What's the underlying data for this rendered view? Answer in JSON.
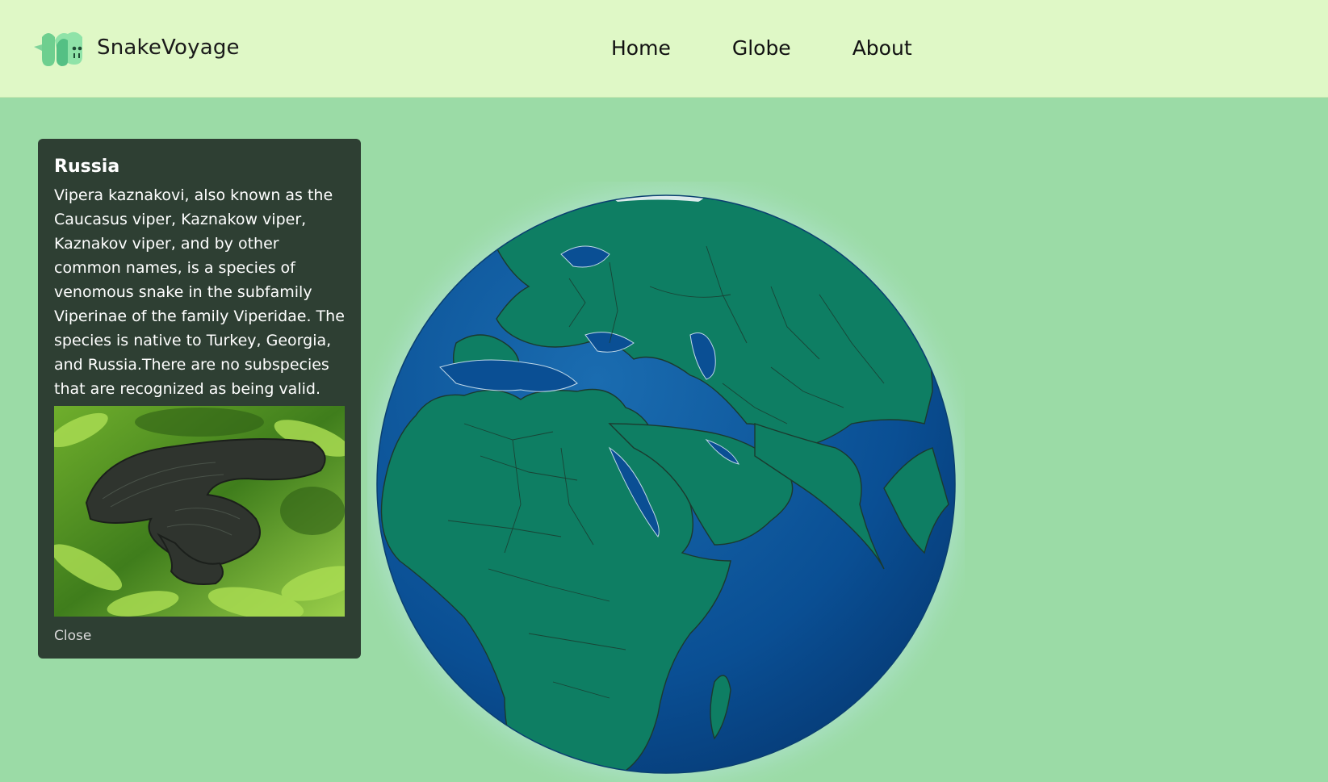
{
  "header": {
    "brand_name": "SnakeVoyage",
    "nav": [
      "Home",
      "Globe",
      "About"
    ]
  },
  "info_panel": {
    "country": "Russia",
    "description": "Vipera kaznakovi, also known as the Caucasus viper, Kaznakow viper, Kaznakov viper, and by other common names, is a species of venomous snake in the subfamily Viperinae of the family Viperidae. The species is native to Turkey, Georgia, and Russia.There are no subspecies that are recognized as being valid.",
    "image_alt": "Vipera kaznakovi",
    "close_label": "Close"
  },
  "colors": {
    "header_bg": "#dff8c6",
    "page_bg": "#9bdba6",
    "panel_bg": "#2e3f33",
    "ocean": "#0a4f94",
    "land": "#0e7e63"
  },
  "icons": {
    "logo": "snake-logo-icon"
  }
}
